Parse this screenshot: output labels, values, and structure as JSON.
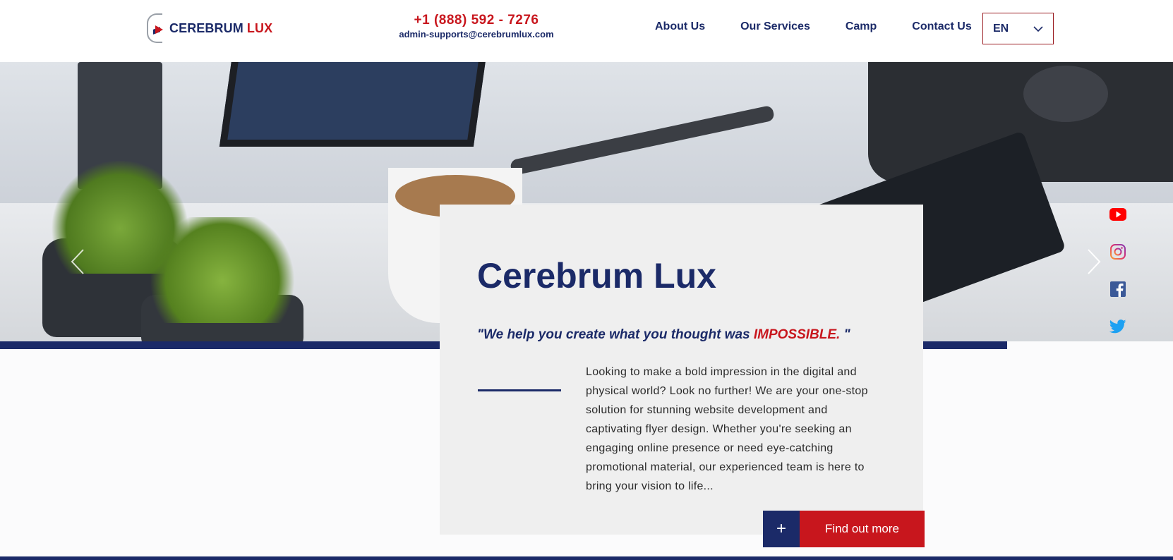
{
  "header": {
    "logo": {
      "text_main": "CEREBRUM",
      "text_accent": "LUX"
    },
    "phone": "+1 (888) 592 - 7276",
    "email": "admin-supports@cerebrumlux.com",
    "nav": [
      {
        "label": "About Us"
      },
      {
        "label": "Our Services"
      },
      {
        "label": "Camp"
      },
      {
        "label": "Contact Us"
      }
    ],
    "language": {
      "selected": "EN"
    }
  },
  "hero": {
    "card": {
      "title": "Cerebrum Lux",
      "quote_start": "\"We help you create what you thought was ",
      "quote_emphasis": "IMPOSSIBLE.",
      "quote_end": " \"",
      "body": "Looking to make a bold impression in the digital and physical world? Look no further! We are your one-stop solution for stunning website development and captivating flyer design. Whether you're seeking an engaging online presence or need eye-catching promotional material, our experienced team is here to bring your vision to life...",
      "button_plus": "+",
      "button_label": "Find out more"
    }
  },
  "social": [
    {
      "icon": "youtube-icon"
    },
    {
      "icon": "instagram-icon"
    },
    {
      "icon": "facebook-icon"
    },
    {
      "icon": "twitter-icon"
    }
  ],
  "colors": {
    "brand_navy": "#1b2a68",
    "brand_red": "#c8161d"
  }
}
